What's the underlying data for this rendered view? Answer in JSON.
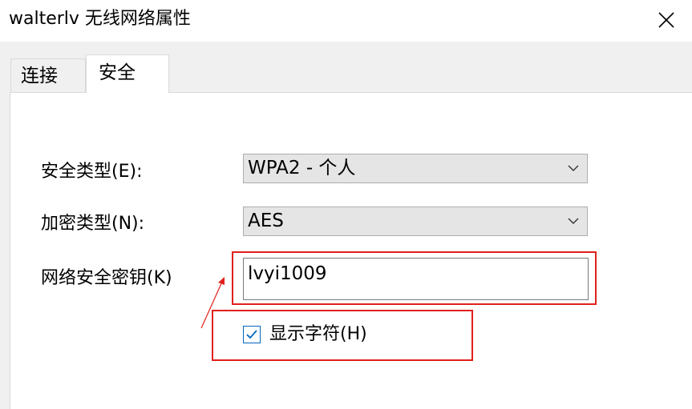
{
  "window": {
    "title": "walterlv 无线网络属性",
    "close_icon": "close-icon"
  },
  "tabs": [
    {
      "label": "连接",
      "selected": false
    },
    {
      "label": "安全",
      "selected": true
    }
  ],
  "form": {
    "security_type": {
      "label": "安全类型(E):",
      "value": "WPA2 - 个人"
    },
    "encryption_type": {
      "label": "加密类型(N):",
      "value": "AES"
    },
    "network_key": {
      "label": "网络安全密钥(K)",
      "value": "lvyi1009"
    },
    "show_characters": {
      "label": "显示字符(H)",
      "checked": true
    }
  },
  "colors": {
    "accent": "#0067c0",
    "annotation": "#e0201c"
  }
}
